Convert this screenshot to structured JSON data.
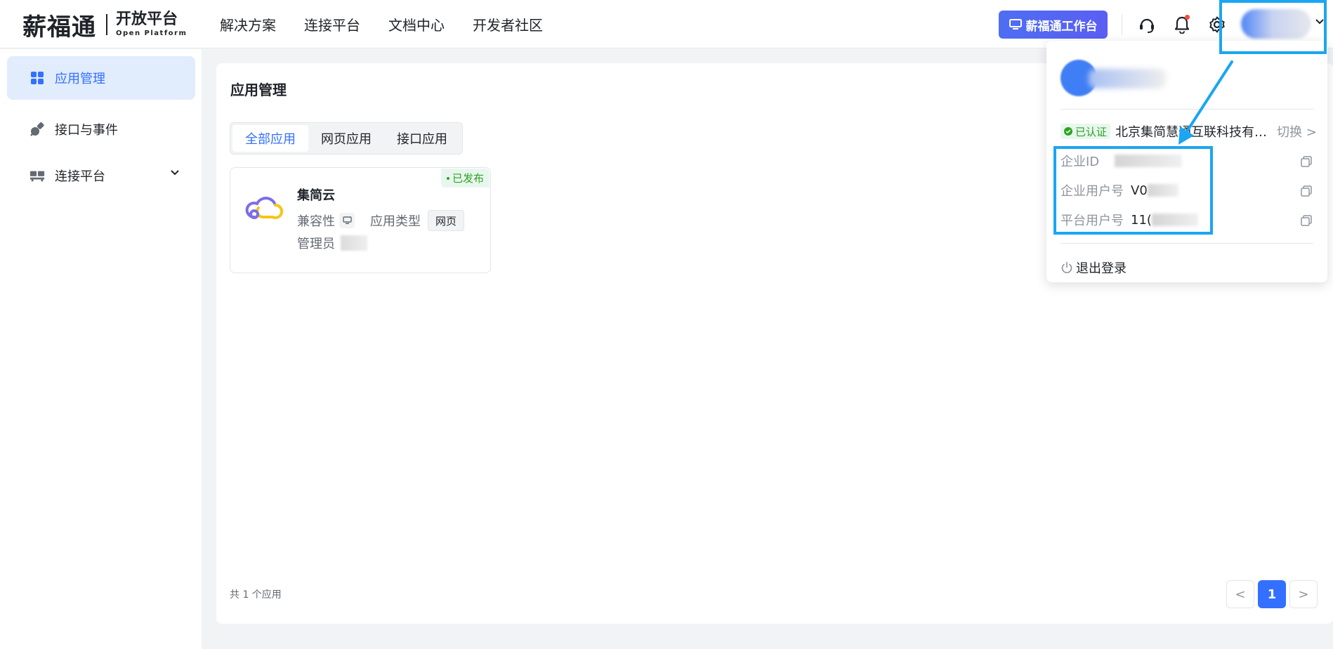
{
  "header": {
    "logo_main": "薪福通",
    "logo_sub_cn": "开放平台",
    "logo_sub_en": "Open Platform",
    "nav": [
      "解决方案",
      "连接平台",
      "文档中心",
      "开发者社区"
    ],
    "workspace_button": "薪福通工作台",
    "icons": [
      "headset-icon",
      "bell-icon",
      "gear-icon"
    ]
  },
  "sidebar": {
    "items": [
      {
        "label": "应用管理",
        "icon": "grid-icon",
        "active": true
      },
      {
        "label": "接口与事件",
        "icon": "plug-icon",
        "active": false
      },
      {
        "label": "连接平台",
        "icon": "connect-icon",
        "active": false
      }
    ]
  },
  "main": {
    "title": "应用管理",
    "tabs": [
      "全部应用",
      "网页应用",
      "接口应用"
    ],
    "card": {
      "status": "已发布",
      "name": "集简云",
      "compat_label": "兼容性",
      "type_label": "应用类型",
      "type_value": "网页",
      "admin_label": "管理员"
    },
    "total": "共 1 个应用",
    "pagination": {
      "prev": "<",
      "current": "1",
      "next": ">"
    }
  },
  "dropdown": {
    "verified": "已认证",
    "company": "北京集简慧通互联科技有限公司",
    "switch": "切换 >",
    "rows": [
      {
        "label": "企业ID",
        "value": ""
      },
      {
        "label": "企业用户号",
        "value": "V0"
      },
      {
        "label": "平台用户号",
        "value": "11("
      }
    ],
    "logout": "退出登录"
  },
  "colors": {
    "accent": "#3370ff",
    "highlight": "#1aa6f2",
    "success": "#2ea121"
  }
}
